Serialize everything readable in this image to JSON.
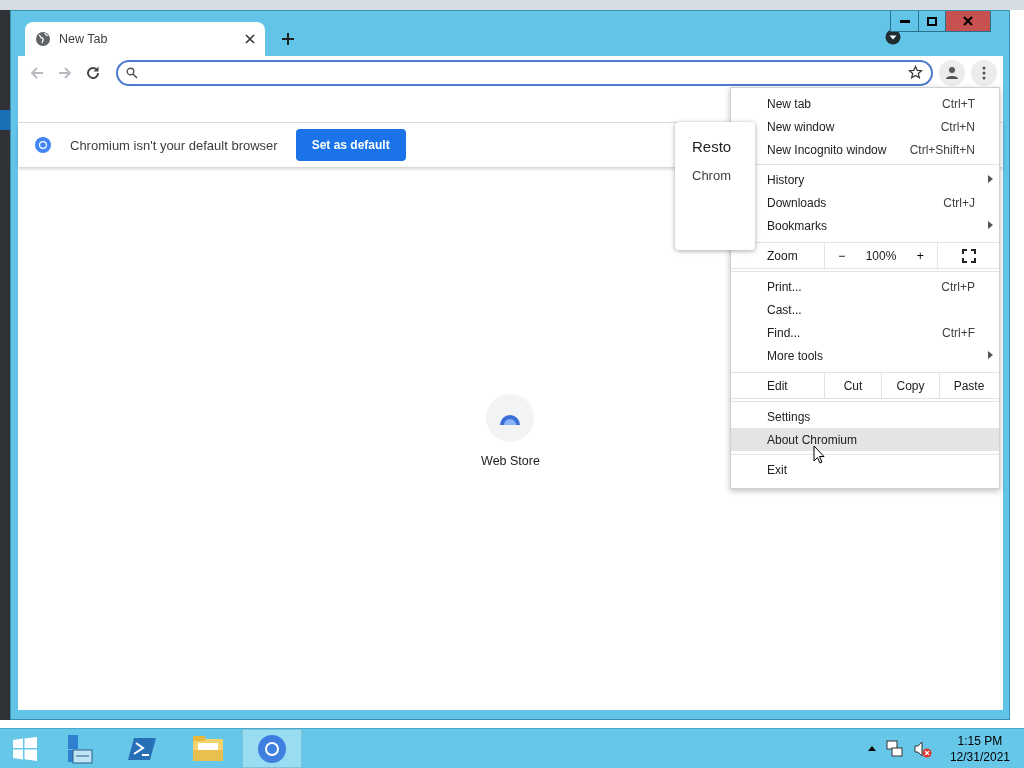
{
  "tabs": [
    {
      "title": "New Tab",
      "selected": true
    }
  ],
  "infobar": {
    "message": "Chromium isn't your default browser",
    "button": "Set as default"
  },
  "restore_popup": {
    "title": "Resto",
    "text": "Chrom"
  },
  "shortcut": {
    "label": "Web Store"
  },
  "menu": {
    "groups": [
      [
        {
          "kind": "item",
          "label": "New tab",
          "shortcut": "Ctrl+T",
          "hovered": false
        },
        {
          "kind": "item",
          "label": "New window",
          "shortcut": "Ctrl+N",
          "hovered": false
        },
        {
          "kind": "item",
          "label": "New Incognito window",
          "shortcut": "Ctrl+Shift+N",
          "hovered": false
        }
      ],
      [
        {
          "kind": "submenu",
          "label": "History",
          "hovered": false
        },
        {
          "kind": "item",
          "label": "Downloads",
          "shortcut": "Ctrl+J",
          "hovered": false
        },
        {
          "kind": "submenu",
          "label": "Bookmarks",
          "hovered": false
        }
      ],
      [
        {
          "kind": "zoom",
          "label": "Zoom",
          "minus": "−",
          "value": "100%",
          "plus": "+",
          "hovered": false
        }
      ],
      [
        {
          "kind": "item",
          "label": "Print...",
          "shortcut": "Ctrl+P",
          "hovered": false
        },
        {
          "kind": "item",
          "label": "Cast...",
          "hovered": false
        },
        {
          "kind": "item",
          "label": "Find...",
          "shortcut": "Ctrl+F",
          "hovered": false
        },
        {
          "kind": "submenu",
          "label": "More tools",
          "hovered": false
        }
      ],
      [
        {
          "kind": "edit",
          "label": "Edit",
          "buttons": [
            "Cut",
            "Copy",
            "Paste"
          ],
          "hovered": false
        }
      ],
      [
        {
          "kind": "item",
          "label": "Settings",
          "hovered": false
        },
        {
          "kind": "item",
          "label": "About Chromium",
          "hovered": true
        }
      ],
      [
        {
          "kind": "item",
          "label": "Exit",
          "hovered": false
        }
      ]
    ]
  },
  "taskbar": {
    "apps": [
      {
        "kind": "server-manager",
        "selected": false
      },
      {
        "kind": "powershell",
        "selected": false
      },
      {
        "kind": "explorer",
        "selected": false
      },
      {
        "kind": "chromium",
        "selected": true
      }
    ],
    "clock": {
      "time": "1:15 PM",
      "date": "12/31/2021"
    }
  }
}
